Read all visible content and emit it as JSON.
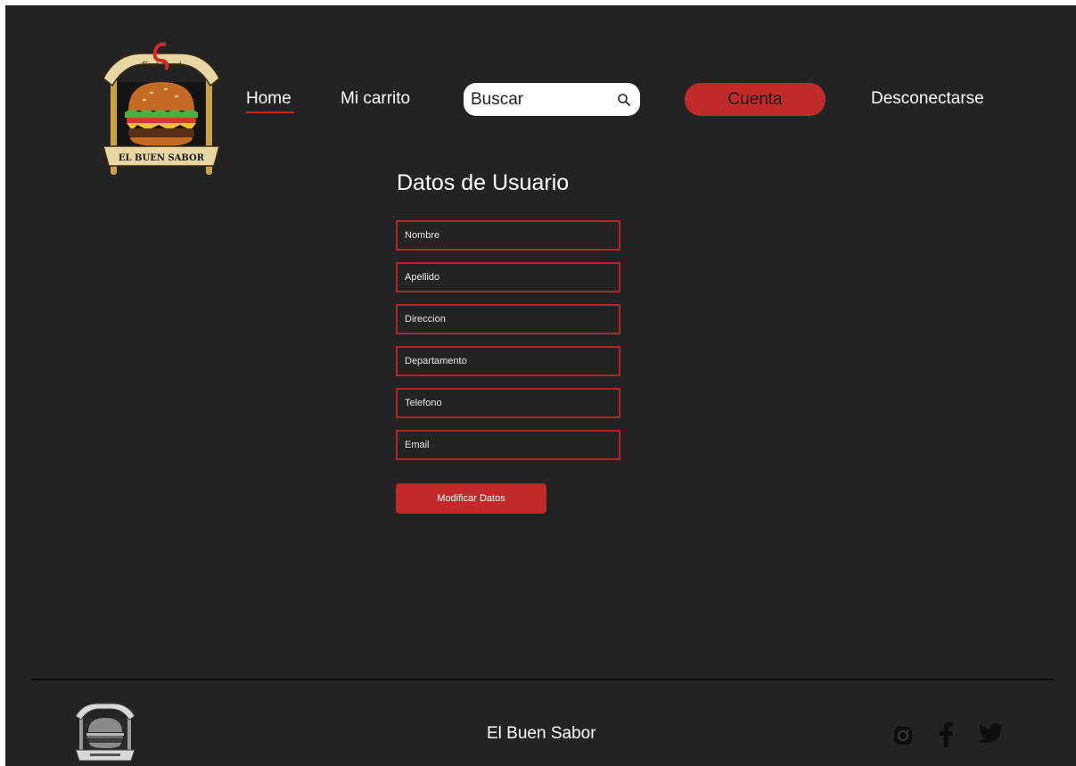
{
  "brand": {
    "logo_top_text": "Fast Food",
    "logo_banner_text": "EL BUEN SABOR"
  },
  "nav": {
    "home_label": "Home",
    "cart_label": "Mi carrito",
    "search_placeholder": "Buscar",
    "account_label": "Cuenta",
    "logout_label": "Desconectarse"
  },
  "form": {
    "title": "Datos de Usuario",
    "fields": [
      {
        "placeholder": "Nombre",
        "value": ""
      },
      {
        "placeholder": "Apellido",
        "value": ""
      },
      {
        "placeholder": "Direccion",
        "value": ""
      },
      {
        "placeholder": "Departamento",
        "value": ""
      },
      {
        "placeholder": "Telefono",
        "value": ""
      },
      {
        "placeholder": "Email",
        "value": ""
      }
    ],
    "submit_label": "Modificar Datos"
  },
  "footer": {
    "brand_name": "El Buen Sabor",
    "social_icons": [
      "instagram-icon",
      "facebook-icon",
      "twitter-icon"
    ]
  },
  "colors": {
    "background": "#232323",
    "accent": "#c12a2a",
    "field_border": "#b3262a",
    "text": "#ffffff"
  }
}
